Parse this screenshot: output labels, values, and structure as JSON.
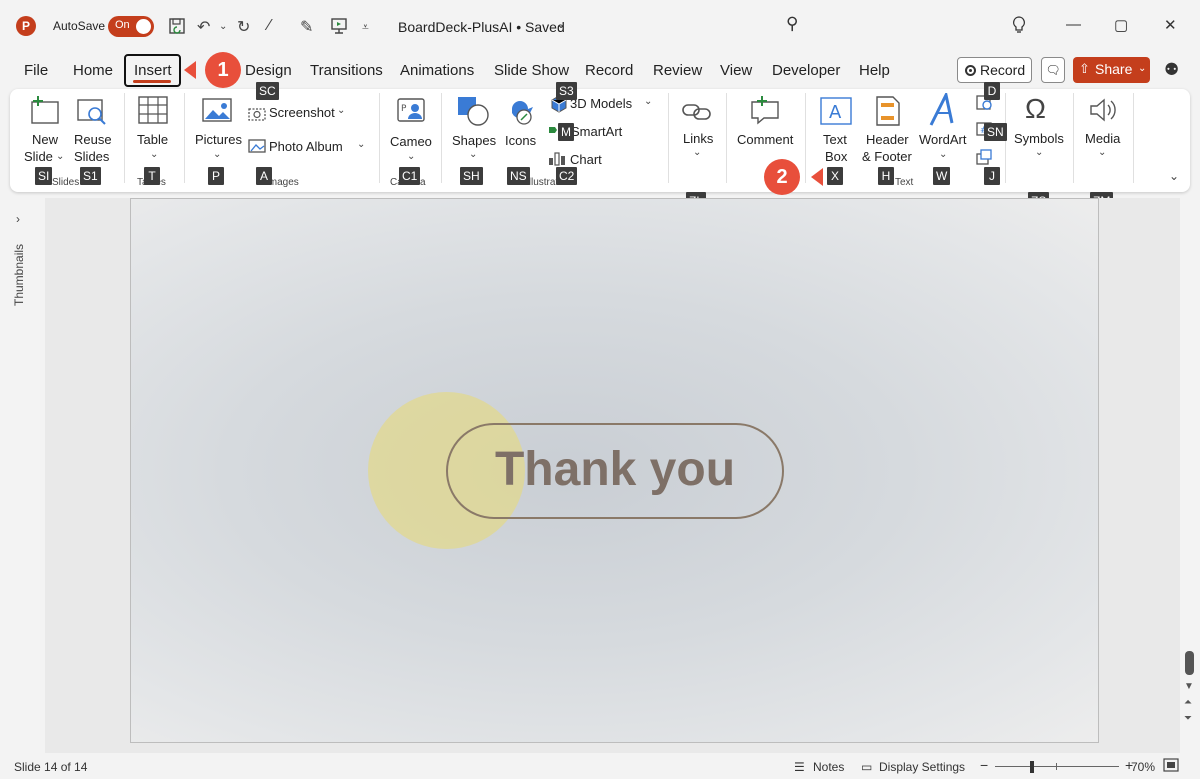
{
  "app": {
    "logo_letter": "P",
    "autosave_label": "AutoSave",
    "autosave_state": "On",
    "doc_title": "BoardDeck-PlusAI • Saved",
    "qat_icons": [
      "save-icon",
      "undo-icon",
      "redo-icon",
      "magic-wand-icon",
      "pen-icon",
      "present-icon",
      "customize-qat-icon"
    ]
  },
  "tabs": [
    "File",
    "Home",
    "Insert",
    "Design",
    "Transitions",
    "Animations",
    "Slide Show",
    "Record",
    "Review",
    "View",
    "Developer",
    "Help"
  ],
  "active_tab": "Insert",
  "callouts": [
    "1",
    "2"
  ],
  "header_right": {
    "record_label": "Record",
    "share_label": "Share"
  },
  "ribbon": {
    "new_slide": [
      "New",
      "Slide"
    ],
    "reuse_slides": [
      "Reuse",
      "Slides"
    ],
    "table": "Table",
    "pictures": "Pictures",
    "screenshot": "Screenshot",
    "photo_album": "Photo Album",
    "cameo": "Cameo",
    "shapes": "Shapes",
    "icons": "Icons",
    "models_3d": "3D Models",
    "smartart": "SmartArt",
    "chart": "Chart",
    "links": "Links",
    "comment": "Comment",
    "text_box": [
      "Text",
      "Box"
    ],
    "header_footer": [
      "Header",
      "& Footer"
    ],
    "wordart": "WordArt",
    "symbols": "Symbols",
    "media": "Media",
    "groups": {
      "slides": "Slides",
      "tables": "Tables",
      "images": "Images",
      "camera": "Camera",
      "illustrations": "Illustrations",
      "text": "Text"
    }
  },
  "keytips": {
    "sl": "SI",
    "s1": "S1",
    "t": "T",
    "p": "P",
    "sc": "SC",
    "a": "A",
    "c1": "C1",
    "sh": "SH",
    "ns": "NS",
    "s3": "S3",
    "m": "M",
    "c2": "C2",
    "zl": "ZL",
    "x": "X",
    "h": "H",
    "w": "W",
    "d": "D",
    "sn": "SN",
    "j": "J",
    "zs": "ZS",
    "zm": "ZM"
  },
  "sidebar": {
    "label": "Thumbnails"
  },
  "slide": {
    "title": "Thank you"
  },
  "status": {
    "slide_count": "Slide 14 of 14",
    "notes": "Notes",
    "display_settings": "Display Settings",
    "zoom": "70%",
    "zoom_level": 0.7
  },
  "colors": {
    "accent": "#c43e1c",
    "callout": "#e84f3b",
    "slide_text": "#7e7067",
    "highlight_circle": "#e1d88e"
  }
}
